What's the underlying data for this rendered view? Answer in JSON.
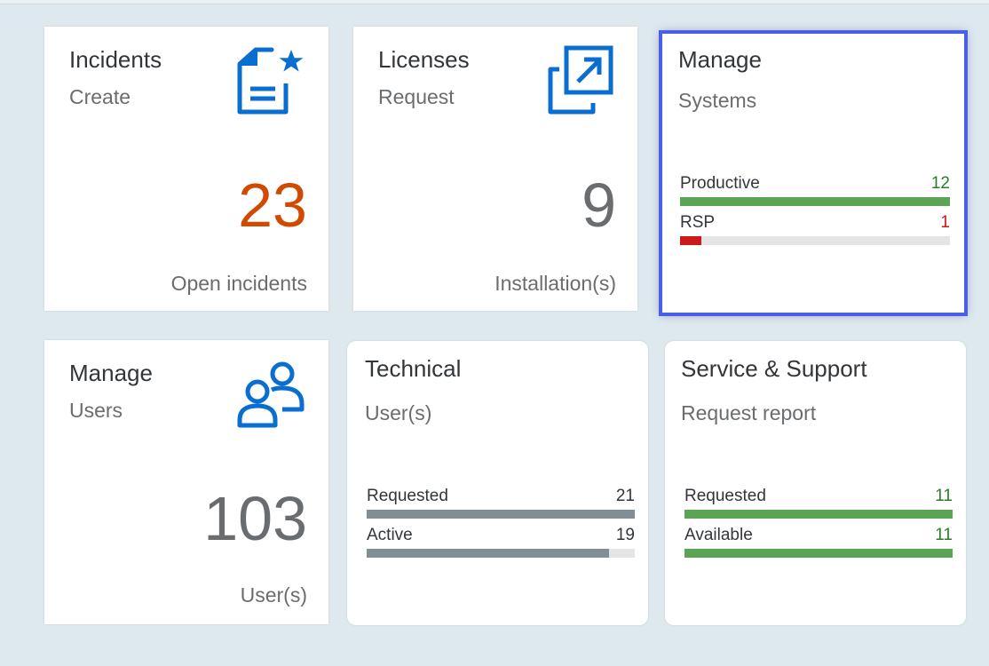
{
  "colors": {
    "critical": "#d04a02",
    "neutral_kpi": "#6a6d70",
    "good": "#2b7d2b",
    "error": "#cc1919",
    "bar_green": "#5aa454",
    "bar_red": "#cc1919",
    "bar_grey": "#828e96",
    "icon_blue": "#0a6ed1",
    "focus_border": "#4a5fe8"
  },
  "tiles": {
    "incidents": {
      "title": "Incidents",
      "subtitle": "Create",
      "kpi": "23",
      "footer": "Open incidents",
      "icon": "document-star-icon"
    },
    "licenses": {
      "title": "Licenses",
      "subtitle": "Request",
      "kpi": "9",
      "footer": "Installation(s)",
      "icon": "open-external-icon"
    },
    "systems": {
      "title": "Manage",
      "subtitle": "Systems",
      "bars": [
        {
          "label": "Productive",
          "value": "12",
          "fraction": 1.0
        },
        {
          "label": "RSP",
          "value": "1",
          "fraction": 0.08
        }
      ]
    },
    "users": {
      "title": "Manage",
      "subtitle": "Users",
      "kpi": "103",
      "footer": "User(s)",
      "icon": "users-icon"
    },
    "technical": {
      "title": "Technical",
      "subtitle": "User(s)",
      "bars": [
        {
          "label": "Requested",
          "value": "21",
          "fraction": 1.0
        },
        {
          "label": "Active",
          "value": "19",
          "fraction": 0.905
        }
      ]
    },
    "service": {
      "title": "Service & Support",
      "subtitle": "Request report",
      "bars": [
        {
          "label": "Requested",
          "value": "11",
          "fraction": 1.0
        },
        {
          "label": "Available",
          "value": "11",
          "fraction": 1.0
        }
      ]
    }
  }
}
